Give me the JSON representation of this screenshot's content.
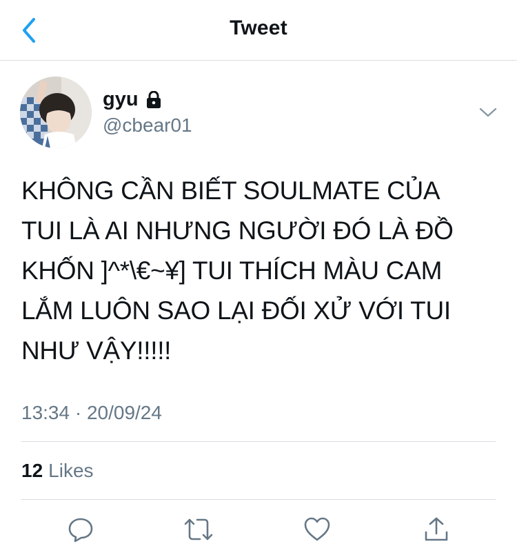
{
  "header": {
    "title": "Tweet",
    "back_icon": "chevron-left-icon",
    "accent_color": "#1da1f2"
  },
  "author": {
    "name": "gyu",
    "handle": "@cbear01",
    "protected_icon": "lock-icon",
    "avatar": "avatar-photo",
    "menu_icon": "chevron-down-icon"
  },
  "tweet": {
    "lines": [
      "KHÔNG CẦN BIẾT SOULMATE CỦA",
      "TUI LÀ AI NHƯNG NGƯỜI ĐÓ LÀ ĐỒ",
      "KHỐN ]^*\\€~¥] TUI THÍCH MÀU CAM",
      "LẮM LUÔN SAO LẠI ĐỐI XỬ VỚI TUI",
      "NHƯ VẬY!!!!!"
    ],
    "timestamp": "13:34 · 20/09/24"
  },
  "stats": {
    "likes_count": "12",
    "likes_label": "Likes"
  },
  "actions": {
    "reply_icon": "reply-icon",
    "retweet_icon": "retweet-icon",
    "like_icon": "heart-icon",
    "share_icon": "share-icon",
    "icon_color": "#657786"
  }
}
